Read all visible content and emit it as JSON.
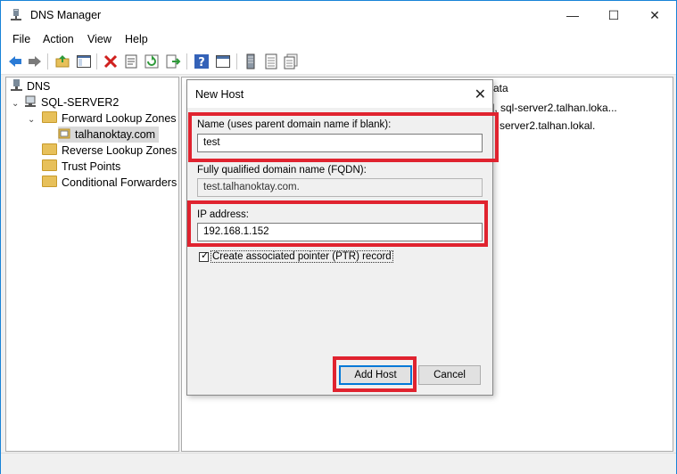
{
  "window": {
    "title": "DNS Manager",
    "controls": {
      "minimize": "—",
      "maximize": "☐",
      "close": "✕"
    }
  },
  "menu": [
    "File",
    "Action",
    "View",
    "Help"
  ],
  "tree": {
    "root": "DNS",
    "server": "SQL-SERVER2",
    "forward_zones": "Forward Lookup Zones",
    "zone": "talhanoktay.com",
    "reverse_zones": "Reverse Lookup Zones",
    "trust_points": "Trust Points",
    "conditional_forwarders": "Conditional Forwarders"
  },
  "right_pane": {
    "column_header": "ata",
    "rows": [
      "], sql-server2.talhan.loka...",
      "server2.talhan.lokal."
    ]
  },
  "dialog": {
    "title": "New Host",
    "close": "✕",
    "name_label": "Name (uses parent domain name if blank):",
    "name_value": "test",
    "fqdn_label": "Fully qualified domain name (FQDN):",
    "fqdn_value": "test.talhanoktay.com.",
    "ip_label": "IP address:",
    "ip_value": "192.168.1.152",
    "ptr_label": "Create associated pointer (PTR) record",
    "ptr_checked": "✓",
    "add_host": "Add Host",
    "cancel": "Cancel"
  },
  "colors": {
    "highlight": "#e0232f",
    "accent": "#0078d7",
    "folder": "#e7c05a"
  },
  "icons": [
    "back-arrow-icon",
    "forward-arrow-icon",
    "folder-up-icon",
    "show-hide-console-tree-icon",
    "delete-icon",
    "properties-icon",
    "refresh-icon",
    "export-list-icon",
    "help-icon",
    "console-icon",
    "server-icon",
    "records-icon"
  ]
}
